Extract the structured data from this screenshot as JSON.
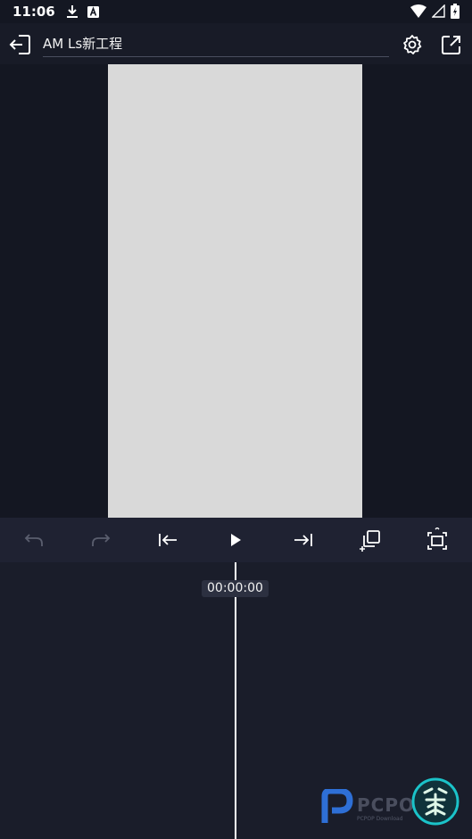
{
  "status_bar": {
    "time": "11:06",
    "icons": [
      "download-icon",
      "a-box-icon",
      "wifi-icon",
      "signal-icon",
      "battery-icon"
    ]
  },
  "app_bar": {
    "title": "AM Ls新工程",
    "icons": [
      "exit-icon",
      "gear-icon",
      "share-icon"
    ]
  },
  "toolbar": {
    "icons": [
      "undo-icon",
      "redo-icon",
      "skip-start-icon",
      "play-icon",
      "skip-end-icon",
      "duplicate-icon",
      "fullscreen-icon"
    ]
  },
  "timeline": {
    "timecode": "00:00:00"
  },
  "watermark": {
    "text": "PCPOP",
    "sub": "PCPOP Download"
  },
  "colors": {
    "background": "#181b27",
    "preview_canvas": "#d9d9d9",
    "accent_teal": "#1bc3c9"
  }
}
